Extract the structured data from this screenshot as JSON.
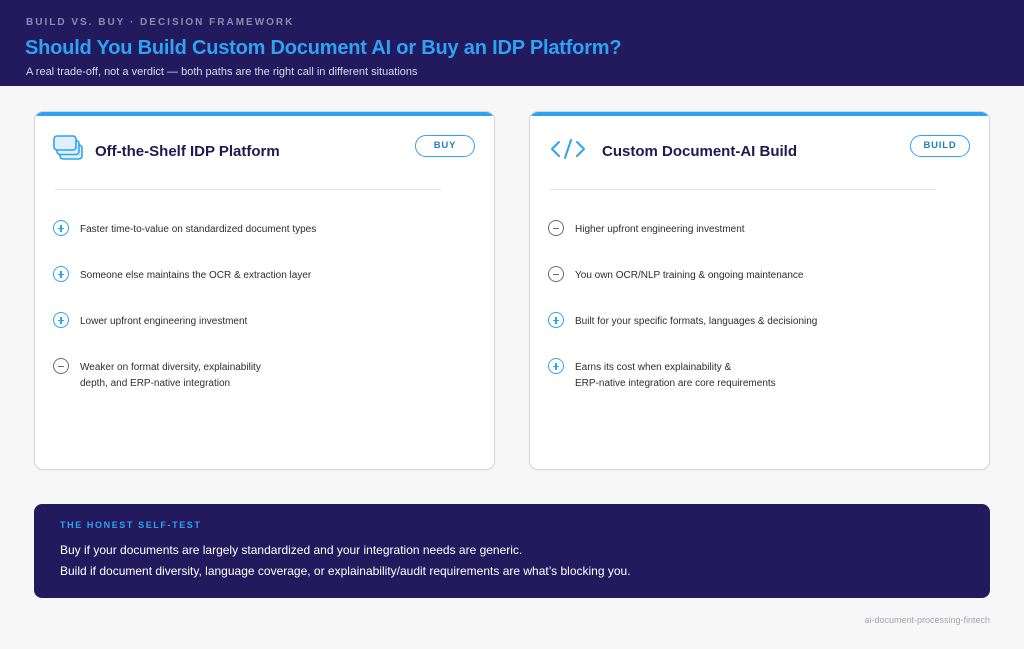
{
  "header": {
    "eyebrow": "BUILD VS. BUY · DECISION FRAMEWORK",
    "title": "Should You Build Custom Document AI or Buy an IDP Platform?",
    "subtitle": "A real trade-off, not a verdict — both paths are the right call in different situations"
  },
  "cards": [
    {
      "icon": "stacked-documents-icon",
      "title": "Off-the-Shelf IDP Platform",
      "badge": "BUY",
      "items": [
        {
          "type": "plus",
          "text": "Faster time-to-value on standardized document types"
        },
        {
          "type": "plus",
          "text": "Someone else maintains the OCR & extraction layer"
        },
        {
          "type": "plus",
          "text": "Lower upfront engineering investment"
        },
        {
          "type": "minus",
          "text_line1": "Weaker on format diversity, explainability",
          "text_line2": "depth, and ERP-native integration"
        }
      ]
    },
    {
      "icon": "code-brackets-icon",
      "title": "Custom Document-AI Build",
      "badge": "BUILD",
      "items": [
        {
          "type": "minus",
          "text": "Higher upfront engineering investment"
        },
        {
          "type": "minus",
          "text": "You own OCR/NLP training & ongoing maintenance"
        },
        {
          "type": "plus",
          "text": "Built for your specific formats, languages & decisioning"
        },
        {
          "type": "plus",
          "text_line1": "Earns its cost when explainability &",
          "text_line2": "ERP-native integration are core requirements"
        }
      ]
    }
  ],
  "selftest": {
    "label": "THE HONEST SELF-TEST",
    "line1": "Buy if your documents are largely standardized and your integration needs are generic.",
    "line2": "Build if document diversity, language coverage, or explainability/audit requirements are what’s blocking you."
  },
  "footer": "ai-document-processing-fintech",
  "colors": {
    "navy": "#231a5e",
    "accent": "#2ea3f2",
    "neutral": "#6b6b73"
  }
}
